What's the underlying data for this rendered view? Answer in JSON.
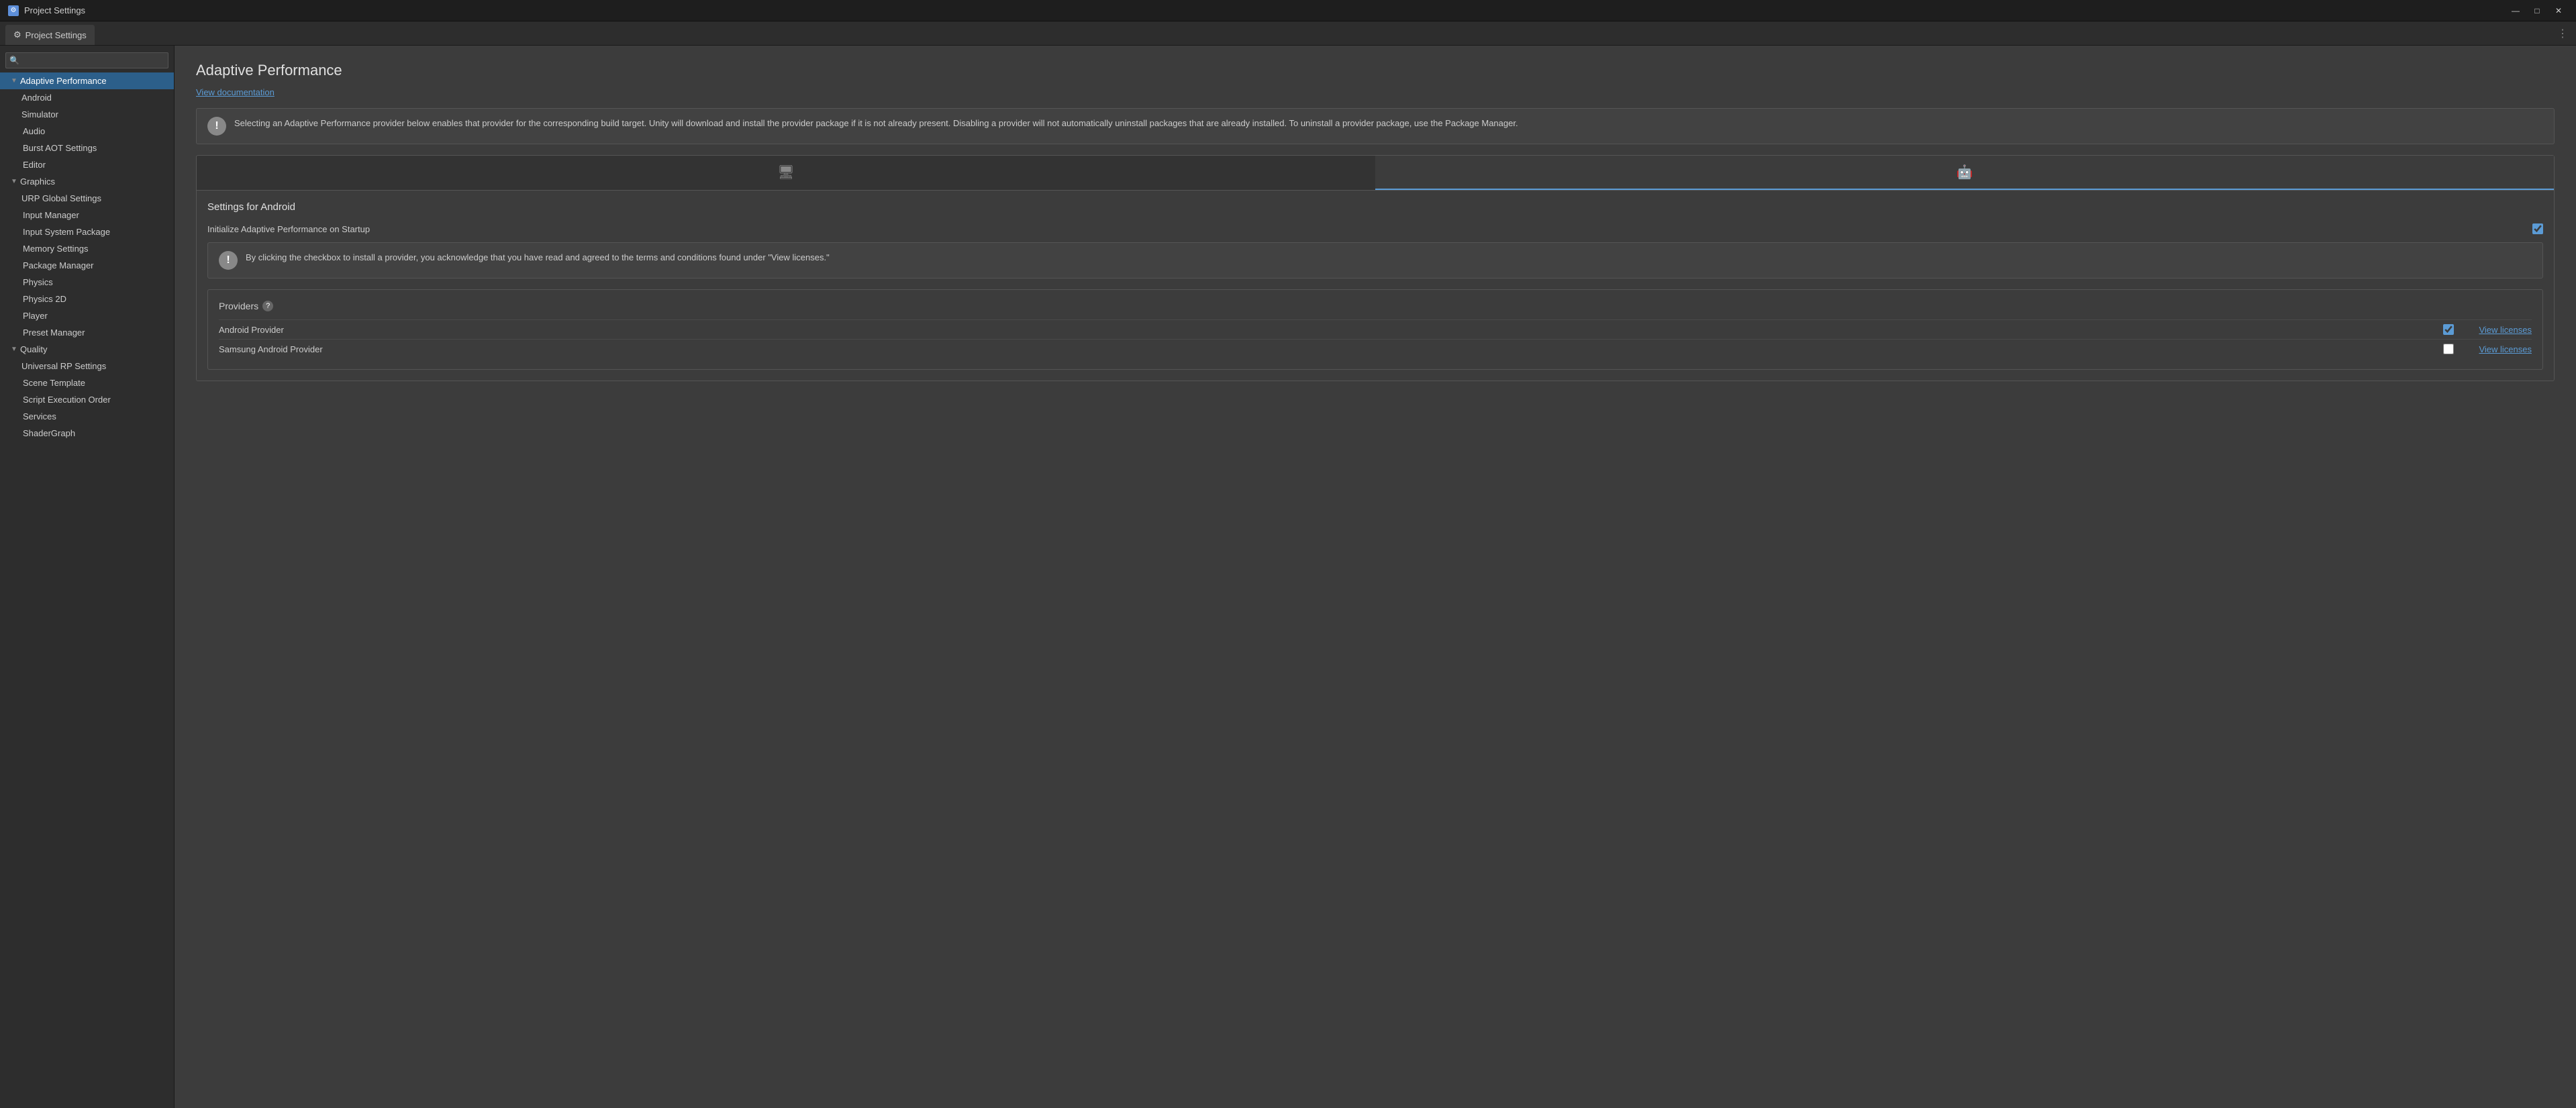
{
  "titlebar": {
    "icon": "⚙",
    "title": "Project Settings",
    "minimize": "—",
    "maximize": "□",
    "close": "✕"
  },
  "tabbar": {
    "tab_label": "Project Settings",
    "tab_icon": "⚙",
    "menu_icon": "⋮"
  },
  "search": {
    "placeholder": ""
  },
  "sidebar": {
    "items": [
      {
        "id": "adaptive-performance",
        "label": "Adaptive Performance",
        "indent": 0,
        "chevron": "down",
        "active": true
      },
      {
        "id": "android",
        "label": "Android",
        "indent": 1,
        "chevron": "",
        "active": false
      },
      {
        "id": "simulator",
        "label": "Simulator",
        "indent": 1,
        "chevron": "",
        "active": false
      },
      {
        "id": "audio",
        "label": "Audio",
        "indent": 0,
        "chevron": "",
        "active": false
      },
      {
        "id": "burst-aot",
        "label": "Burst AOT Settings",
        "indent": 0,
        "chevron": "",
        "active": false
      },
      {
        "id": "editor",
        "label": "Editor",
        "indent": 0,
        "chevron": "",
        "active": false
      },
      {
        "id": "graphics",
        "label": "Graphics",
        "indent": 0,
        "chevron": "down",
        "active": false
      },
      {
        "id": "urp-global",
        "label": "URP Global Settings",
        "indent": 1,
        "chevron": "",
        "active": false
      },
      {
        "id": "input-manager",
        "label": "Input Manager",
        "indent": 0,
        "chevron": "",
        "active": false
      },
      {
        "id": "input-system",
        "label": "Input System Package",
        "indent": 0,
        "chevron": "",
        "active": false
      },
      {
        "id": "memory-settings",
        "label": "Memory Settings",
        "indent": 0,
        "chevron": "",
        "active": false
      },
      {
        "id": "package-manager",
        "label": "Package Manager",
        "indent": 0,
        "chevron": "",
        "active": false
      },
      {
        "id": "physics",
        "label": "Physics",
        "indent": 0,
        "chevron": "",
        "active": false
      },
      {
        "id": "physics-2d",
        "label": "Physics 2D",
        "indent": 0,
        "chevron": "",
        "active": false
      },
      {
        "id": "player",
        "label": "Player",
        "indent": 0,
        "chevron": "",
        "active": false
      },
      {
        "id": "preset-manager",
        "label": "Preset Manager",
        "indent": 0,
        "chevron": "",
        "active": false
      },
      {
        "id": "quality",
        "label": "Quality",
        "indent": 0,
        "chevron": "down",
        "active": false
      },
      {
        "id": "universal-rp",
        "label": "Universal RP Settings",
        "indent": 1,
        "chevron": "",
        "active": false
      },
      {
        "id": "scene-template",
        "label": "Scene Template",
        "indent": 0,
        "chevron": "",
        "active": false
      },
      {
        "id": "script-execution",
        "label": "Script Execution Order",
        "indent": 0,
        "chevron": "",
        "active": false
      },
      {
        "id": "services",
        "label": "Services",
        "indent": 0,
        "chevron": "",
        "active": false
      },
      {
        "id": "shadergraph",
        "label": "ShaderGraph",
        "indent": 0,
        "chevron": "",
        "active": false
      }
    ]
  },
  "content": {
    "title": "Adaptive Performance",
    "view_doc_label": "View documentation",
    "info_text": "Selecting an Adaptive Performance provider below enables that provider for the corresponding build target. Unity will download and install the provider package if it is not already present. Disabling a provider will not automatically uninstall packages that are already installed. To uninstall a provider package, use the Package Manager.",
    "platform_tabs": [
      {
        "id": "desktop",
        "icon": "🖥",
        "active": false
      },
      {
        "id": "android",
        "icon": "🤖",
        "active": true
      }
    ],
    "settings_for_android": "Settings for Android",
    "initialize_label": "Initialize Adaptive Performance on Startup",
    "initialize_checked": true,
    "checkbox_notice": "By clicking the checkbox to install a provider, you acknowledge that you have read and agreed to the terms and conditions found under \"View licenses.\"",
    "providers_label": "Providers",
    "providers": [
      {
        "id": "android-provider",
        "name": "Android Provider",
        "checked": true,
        "view_licenses": "View licenses"
      },
      {
        "id": "samsung-provider",
        "name": "Samsung Android Provider",
        "checked": false,
        "view_licenses": "View licenses"
      }
    ]
  }
}
